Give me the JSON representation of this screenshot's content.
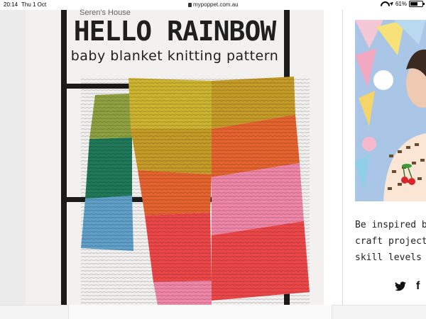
{
  "status_bar": {
    "time": "20:14",
    "date": "Thu 1 Oct",
    "url": "mypoppet.com.au",
    "battery": "61%",
    "battery_level": 0.61
  },
  "hero": {
    "title": "HELLO RAINBOW",
    "subtitle": "baby blanket knitting pattern",
    "colors": {
      "olive": "#8fa041",
      "green": "#1f7857",
      "blue": "#5f9fc8",
      "mustard": "#c59b27",
      "orange": "#e4632f",
      "pink": "#ef86a8",
      "red": "#ec4748",
      "yellow": "#cdb430"
    }
  },
  "sidebar": {
    "text_lines": [
      "Be inspired b",
      "craft project",
      "skill levels"
    ],
    "social": {
      "twitter_icon": "twitter-icon",
      "facebook_label": "f"
    }
  },
  "bottom": {
    "label": "Seren's House"
  }
}
